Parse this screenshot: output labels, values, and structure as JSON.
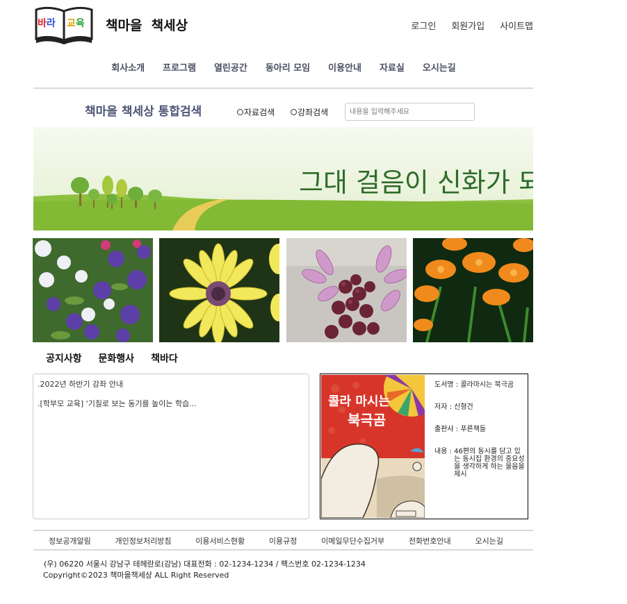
{
  "logo": {
    "left_text": "바라",
    "right_text": "교육"
  },
  "header": {
    "site_title": "책마을  책세상"
  },
  "top_links": [
    {
      "label": "로그인"
    },
    {
      "label": "회원가입"
    },
    {
      "label": "사이트맵"
    }
  ],
  "nav": [
    {
      "label": "회사소개"
    },
    {
      "label": "프로그램"
    },
    {
      "label": "열린공간"
    },
    {
      "label": "동아리 모임"
    },
    {
      "label": "이용안내"
    },
    {
      "label": "자료실"
    },
    {
      "label": "오시는길"
    }
  ],
  "search": {
    "title": "책마을 책세상 통합검색",
    "radio_1": "자료검색",
    "radio_2": "강좌검색",
    "placeholder": "내용을 입력해주세요"
  },
  "banner": {
    "slogan": "그대 걸음이 신화가 되다"
  },
  "tabs": [
    {
      "label": "공지사항"
    },
    {
      "label": "문화행사"
    },
    {
      "label": "책바다"
    }
  ],
  "notices": [
    {
      "text": ".2022년 하반기 강좌 안내"
    },
    {
      "text": ".[학부모 교육] '기질로 보는 동기를 높이는 학습..."
    }
  ],
  "book": {
    "cover_title_line1": "콜라 마시는",
    "cover_title_line2": "북극곰",
    "title_label": "도서명 : ",
    "title_value": "콜라마시는 북극곰",
    "author_label": "저자 : ",
    "author_value": "신형건",
    "publisher_label": "출판사 : ",
    "publisher_value": "푸른책들",
    "content_label": "내용 : ",
    "content_value": "46편의 동시를 담고 있는 동시집 환경의 중요성을 생각하게 하는 물음을 제시"
  },
  "footer": {
    "links": [
      {
        "label": "정보공개알림"
      },
      {
        "label": "개인정보처리방침"
      },
      {
        "label": "이용서비스현황"
      },
      {
        "label": "이용규정"
      },
      {
        "label": "이메일무단수집거부"
      },
      {
        "label": "전화번호안내"
      },
      {
        "label": "오시는길"
      }
    ],
    "address": "(우) 06220 서울시 강남구 테헤란로(강남) 대표전화 : 02-1234-1234 / 팩스번호 02-1234-1234",
    "copyright": "Copyright©2023 책마을책세상 ALL Right Reserved"
  },
  "colors": {
    "nav_text": "#4a4f63",
    "search_title": "#4e5677",
    "banner_sky": "#eef5dd",
    "banner_grass": "#8cc13f",
    "slogan": "#2e6b2a"
  }
}
